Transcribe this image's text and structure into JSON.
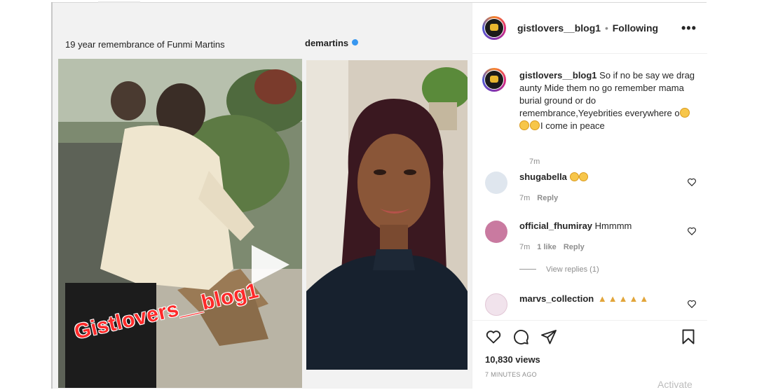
{
  "post": {
    "left_caption": "19 year remembrance of Funmi Martins",
    "right_caption": "demartins",
    "watermark": "Gistlovers__blog1"
  },
  "header": {
    "username": "gistlovers__blog1",
    "separator": "•",
    "follow_status": "Following",
    "more_glyph": "•••"
  },
  "caption": {
    "username": "gistlovers__blog1",
    "text_part1": "So if no be say we drag aunty Mide them no go remember mama burial ground or do remembrance,Yeyebrities everywhere o",
    "text_part2": "I come in peace",
    "time": "7m"
  },
  "comments": [
    {
      "username": "shugabella",
      "text": "",
      "time": "7m",
      "likes": "",
      "reply": "Reply"
    },
    {
      "username": "official_fhumiray",
      "text": "Hmmmm",
      "time": "7m",
      "likes": "1 like",
      "reply": "Reply"
    },
    {
      "username": "marvs_collection",
      "text": "",
      "time": "",
      "likes": "",
      "reply": ""
    }
  ],
  "view_replies": "View replies (1)",
  "stats": {
    "views": "10,830 views",
    "time_ago": "7 MINUTES AGO"
  },
  "overlay": {
    "activate": "Activate"
  },
  "icons": [
    "heart-icon",
    "comment-icon",
    "share-icon",
    "bookmark-icon",
    "play-icon",
    "more-icon"
  ],
  "colors": {
    "accent": "#3897f0",
    "watermark": "#ff2a2a",
    "text": "#262626",
    "muted": "#8e8e8e"
  }
}
